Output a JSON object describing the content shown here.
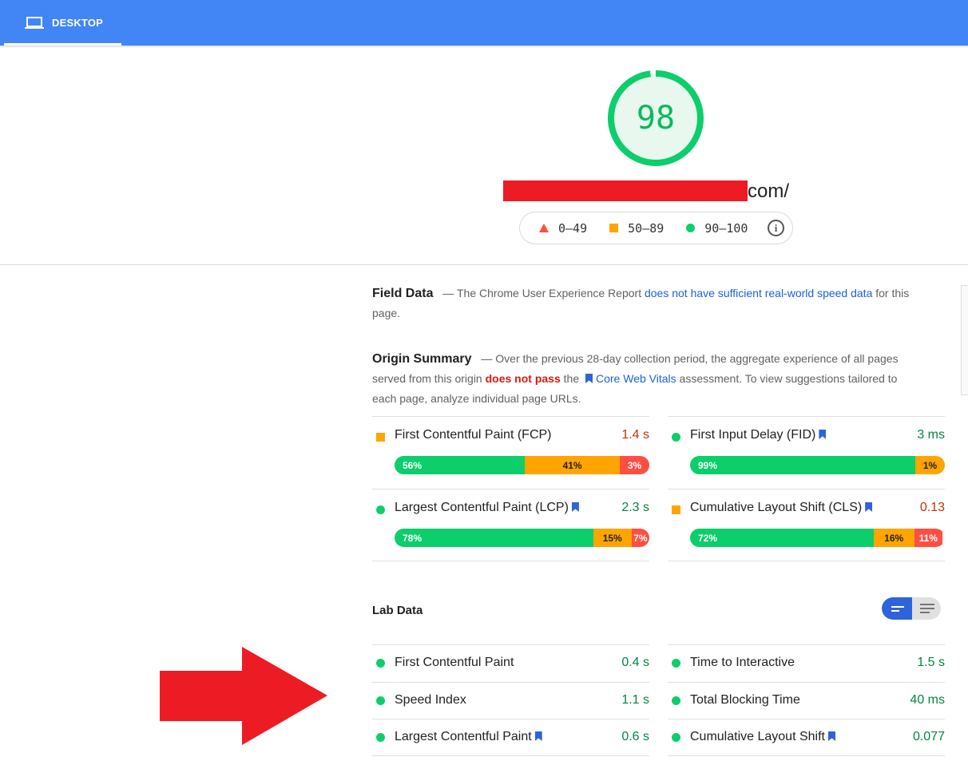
{
  "header": {
    "tab_label": "DESKTOP"
  },
  "score": {
    "value": "98",
    "fraction": 0.98,
    "color": "#0cce6b"
  },
  "url_suffix": "com/",
  "legend": {
    "items": [
      {
        "range": "0–49",
        "icon": "triangle-icon"
      },
      {
        "range": "50–89",
        "icon": "square-icon"
      },
      {
        "range": "90–100",
        "icon": "circle-icon"
      }
    ],
    "info_icon": "i"
  },
  "field_data": {
    "heading": "Field Data",
    "text_before": "— The Chrome User Experience Report ",
    "link": "does not have sufficient real-world speed data",
    "text_after": " for this page."
  },
  "origin_summary": {
    "heading": "Origin Summary",
    "text_1": "— Over the previous 28-day collection period, the aggregate experience of all pages served from this origin ",
    "fail_text": "does not pass",
    "text_2": " the ",
    "link": "Core Web Vitals",
    "text_3": " assessment. To view suggestions tailored to each page, analyze individual page URLs."
  },
  "origin_metrics": [
    {
      "name": "First Contentful Paint (FCP)",
      "value": "1.4 s",
      "status": "average",
      "bookmark": false,
      "dist": [
        {
          "pct": 56,
          "label": "56%"
        },
        {
          "pct": 41,
          "label": "41%"
        },
        {
          "pct": 3,
          "label": "3%"
        }
      ]
    },
    {
      "name": "First Input Delay (FID)",
      "value": "3 ms",
      "status": "good",
      "bookmark": true,
      "dist": [
        {
          "pct": 99,
          "label": "99%"
        },
        {
          "pct": 1,
          "label": "1%"
        },
        {
          "pct": 0,
          "label": ""
        }
      ]
    },
    {
      "name": "Largest Contentful Paint (LCP)",
      "value": "2.3 s",
      "status": "good",
      "bookmark": true,
      "dist": [
        {
          "pct": 78,
          "label": "78%"
        },
        {
          "pct": 15,
          "label": "15%"
        },
        {
          "pct": 7,
          "label": "7%"
        }
      ]
    },
    {
      "name": "Cumulative Layout Shift (CLS)",
      "value": "0.13",
      "status": "average",
      "bookmark": true,
      "dist": [
        {
          "pct": 72,
          "label": "72%"
        },
        {
          "pct": 16,
          "label": "16%"
        },
        {
          "pct": 11,
          "label": "11%"
        }
      ]
    }
  ],
  "lab_data": {
    "heading": "Lab Data",
    "metrics": [
      {
        "name": "First Contentful Paint",
        "value": "0.4 s",
        "bookmark": false
      },
      {
        "name": "Time to Interactive",
        "value": "1.5 s",
        "bookmark": false
      },
      {
        "name": "Speed Index",
        "value": "1.1 s",
        "bookmark": false
      },
      {
        "name": "Total Blocking Time",
        "value": "40 ms",
        "bookmark": false
      },
      {
        "name": "Largest Contentful Paint",
        "value": "0.6 s",
        "bookmark": true
      },
      {
        "name": "Cumulative Layout Shift",
        "value": "0.077",
        "bookmark": true
      }
    ]
  },
  "colors": {
    "good": "#0cce6b",
    "average": "#ffa400",
    "poor": "#ff4e42",
    "header": "#4285f4",
    "arrow": "#ed1c24"
  }
}
